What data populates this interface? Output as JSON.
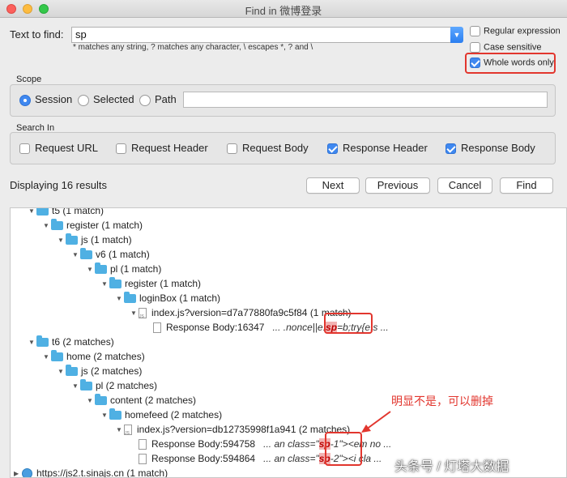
{
  "window": {
    "title": "Find in 微博登录"
  },
  "find": {
    "label": "Text to find:",
    "value": "sp",
    "hint": "* matches any string, ? matches any character, \\ escapes *, ? and \\"
  },
  "options": {
    "regex": {
      "label": "Regular expression",
      "checked": false
    },
    "case_sensitive": {
      "label": "Case sensitive",
      "checked": false
    },
    "whole_words": {
      "label": "Whole words only",
      "checked": true
    }
  },
  "scope": {
    "title": "Scope",
    "session": "Session",
    "selected": "Selected",
    "path": "Path",
    "selected_value": "Session"
  },
  "search_in": {
    "title": "Search In",
    "items": [
      {
        "label": "Request URL",
        "checked": false
      },
      {
        "label": "Request Header",
        "checked": false
      },
      {
        "label": "Request Body",
        "checked": false
      },
      {
        "label": "Response Header",
        "checked": true
      },
      {
        "label": "Response Body",
        "checked": true
      }
    ]
  },
  "results": {
    "summary": "Displaying 16 results",
    "buttons": {
      "next": "Next",
      "previous": "Previous",
      "cancel": "Cancel",
      "find": "Find"
    }
  },
  "tree": {
    "t5": "t5 (1 match)",
    "register": "register (1 match)",
    "js": "js (1 match)",
    "v6": "v6 (1 match)",
    "pl": "pl (1 match)",
    "register2": "register (1 match)",
    "loginbox": "loginBox (1 match)",
    "file1": "index.js?version=d7a77880fa9c5f84 (1 match)",
    "body1": {
      "label": "Response Body:16347",
      "pre": "... .nonce||e.",
      "match": "sp",
      "post": "=b;try{e.s ..."
    },
    "t6": "t6 (2 matches)",
    "home": "home (2 matches)",
    "js2": "js (2 matches)",
    "pl2": "pl (2 matches)",
    "content": "content (2 matches)",
    "homefeed": "homefeed (2 matches)",
    "file2": "index.js?version=db12735998f1a941 (2 matches)",
    "body2": {
      "label": "Response Body:594758",
      "pre": "... an class=\"",
      "match": "sp",
      "post": "-1\"><em no ..."
    },
    "body3": {
      "label": "Response Body:594864",
      "pre": "... an class=\"",
      "match": "sp",
      "post": "-2\"><i cla ..."
    },
    "host": "https://js2.t.sinajs.cn (1 match)"
  },
  "annotation": "明显不是，可以删掉",
  "watermark": "头条号 / 灯塔大数据",
  "colors": {
    "accent": "#3f88f0",
    "annotation": "#e2362e",
    "folder": "#4fb0e3"
  }
}
